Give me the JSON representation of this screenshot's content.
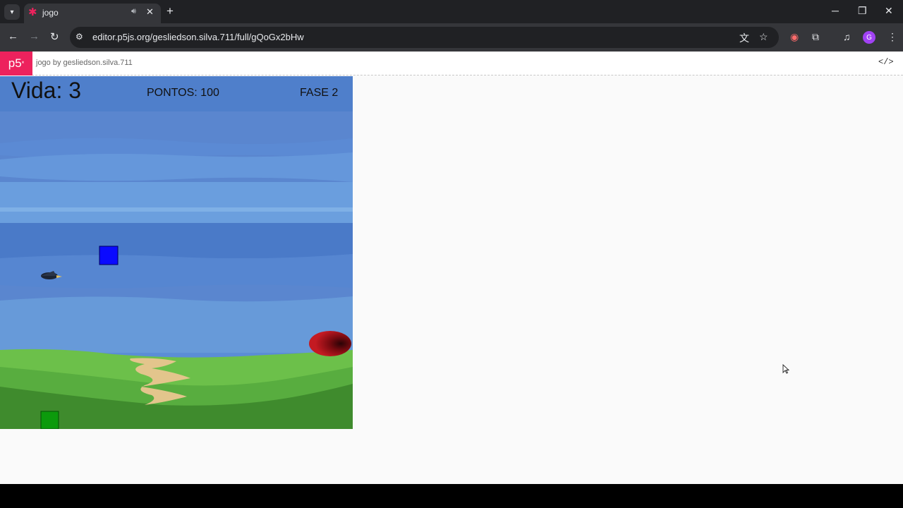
{
  "browser": {
    "tab": {
      "title": "jogo"
    },
    "url": "editor.p5js.org/gesliedson.silva.711/full/gQoGx2bHw",
    "profile_initial": "G"
  },
  "p5": {
    "logo": "p5",
    "logo_sup": "*",
    "sketch_title": "jogo",
    "by": "by",
    "author": "gesliedson.silva.711"
  },
  "game": {
    "vida_label": "Vida: 3",
    "pontos_label": "PONTOS: 100",
    "fase_label": "FASE 2",
    "colors": {
      "sky": "#5a86cf",
      "ground": "#3e8a2c",
      "player": "#0a0aff",
      "target": "#0c9a0c",
      "portal": "#b10e16"
    }
  }
}
